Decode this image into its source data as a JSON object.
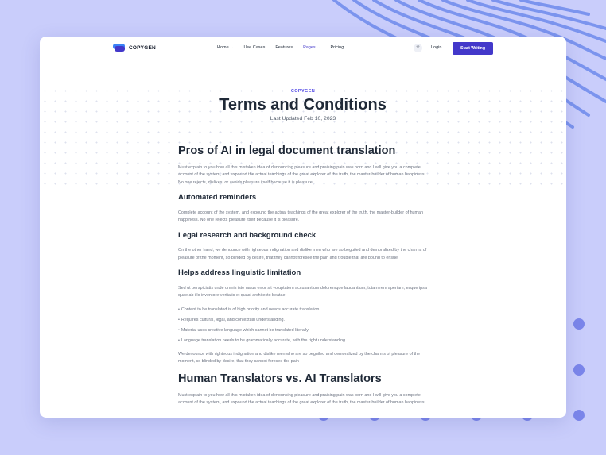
{
  "colors": {
    "background": "#c9cdfb",
    "accent": "#4338ca",
    "decor": "#7b86ea"
  },
  "nav": {
    "brand": "COPYGEN",
    "items": [
      {
        "label": "Home",
        "has_dropdown": true,
        "active": false
      },
      {
        "label": "Use Cases",
        "has_dropdown": false,
        "active": false
      },
      {
        "label": "Features",
        "has_dropdown": false,
        "active": false
      },
      {
        "label": "Pages",
        "has_dropdown": true,
        "active": true
      },
      {
        "label": "Pricing",
        "has_dropdown": false,
        "active": false
      }
    ],
    "dropdown_glyph": "⌄",
    "theme_icon": "sun-icon",
    "theme_glyph": "☀",
    "login": "Login",
    "cta": "Start Writing"
  },
  "hero": {
    "eyebrow": "COPYGEN",
    "title": "Terms and Conditions",
    "updated": "Last Updated Feb 10, 2023"
  },
  "content": {
    "h1": "Pros of AI in legal document translation",
    "p1": "Must explain to you how all this mistaken idea of denouncing pleasure and praising pain was born and I will give you a complete account of the system, and expound the actual teachings of the great explorer of the truth, the master-builder of human happiness. No one rejects, dislikes, or avoids pleasure itself,because it is pleasure.",
    "h2": "Automated reminders",
    "p2": "Complete account of the system, and expound the actual teachings of the great explorer of the truth, the master-builder of human happiness. No one rejects pleasure itself because it is pleasure.",
    "h3": "Legal research and background check",
    "p3": "On the other hand, we denounce with righteous indignation and dislike men who are so beguiled and demoralized by the charms of pleasure of the moment, so blinded by desire, that they cannot foresee the pain and trouble that are bound to ensue.",
    "h4": "Helps address linguistic limitation",
    "p4": "Sed ut perspiciatis unde omnis iste natus error sit voluptatem accusantium doloremque laudantium, totam rem aperiam, eaque ipsa quae ab illo inventore veritatis et quasi architecto beatae",
    "bullets": [
      "Content to be translated is of high priority and needs accurate translation.",
      "Requires cultural, legal, and contextual understanding.",
      "Material uses creative language which cannot be translated literally.",
      "Language translation needs to be grammatically accurate, with the right understanding"
    ],
    "p5": "We denounce with righteous indignation and dislike men who are so beguiled and demoralized by the charms of pleasure of the moment, so blinded by desire, that they cannot foresee the pain",
    "h5": "Human Translators vs. AI Translators",
    "p6": "Must explain to you how all this mistaken idea of denouncing pleasure and praising pain was born and I will give you a complete account of the system, and expound the actual teachings of the great explorer of the truth, the master-builder of human happiness."
  }
}
